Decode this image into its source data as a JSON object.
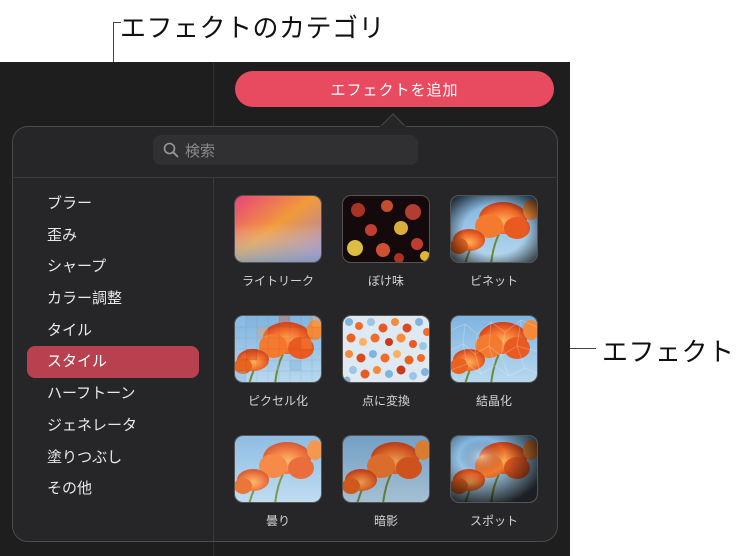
{
  "callouts": {
    "categories_label": "エフェクトのカテゴリ",
    "effects_label": "エフェクト"
  },
  "toolbar": {
    "add_effect_label": "エフェクトを追加"
  },
  "search": {
    "placeholder": "検索"
  },
  "categories": [
    {
      "label": "ブラー",
      "selected": false
    },
    {
      "label": "歪み",
      "selected": false
    },
    {
      "label": "シャープ",
      "selected": false
    },
    {
      "label": "カラー調整",
      "selected": false
    },
    {
      "label": "タイル",
      "selected": false
    },
    {
      "label": "スタイル",
      "selected": true
    },
    {
      "label": "ハーフトーン",
      "selected": false
    },
    {
      "label": "ジェネレータ",
      "selected": false
    },
    {
      "label": "塗りつぶし",
      "selected": false
    },
    {
      "label": "その他",
      "selected": false
    }
  ],
  "effects": [
    {
      "label": "ライトリーク",
      "thumbnail": "light-leak"
    },
    {
      "label": "ぼけ味",
      "thumbnail": "bokeh"
    },
    {
      "label": "ビネット",
      "thumbnail": "vignette-flower"
    },
    {
      "label": "ピクセル化",
      "thumbnail": "pixelated-flower"
    },
    {
      "label": "点に変換",
      "thumbnail": "pointillize-flower"
    },
    {
      "label": "結晶化",
      "thumbnail": "crystallize-flower"
    },
    {
      "label": "曇り",
      "thumbnail": "gloom-flower"
    },
    {
      "label": "暗影",
      "thumbnail": "shadow-flower"
    },
    {
      "label": "スポット",
      "thumbnail": "spotlight-flower"
    }
  ],
  "colors": {
    "accent_button": "#e84a5f",
    "selected_category": "#b8414f",
    "panel_background": "#262628"
  }
}
